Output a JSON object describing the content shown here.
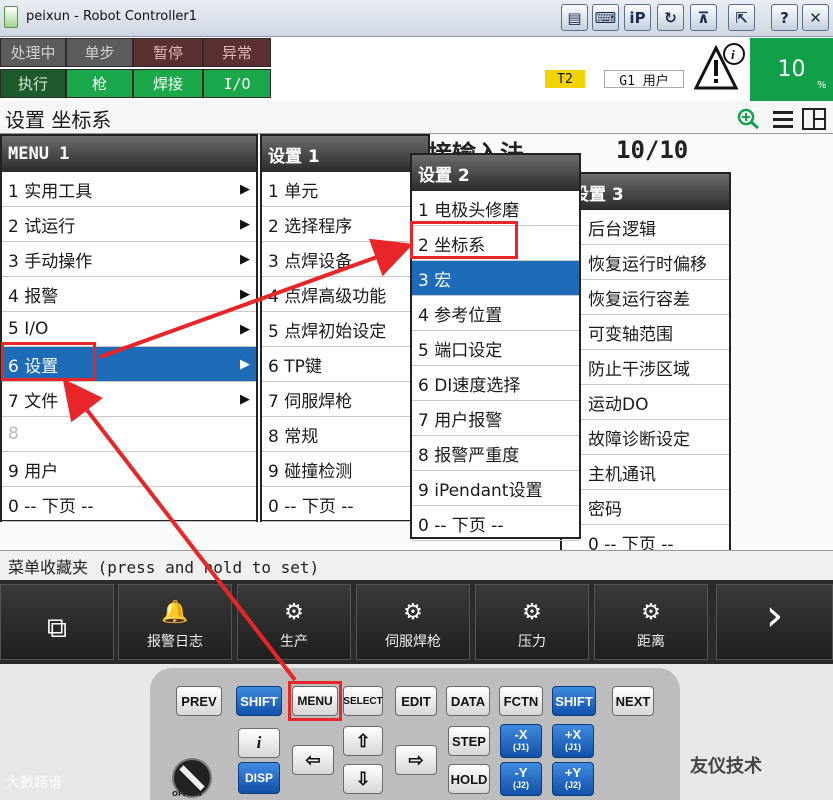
{
  "window": {
    "title": "peixun - Robot Controller1"
  },
  "toolbar": {
    "buttons": [
      {
        "icon": "document-icon",
        "glyph": "▤"
      },
      {
        "icon": "keyboard-icon",
        "glyph": "⌨"
      },
      {
        "icon": "ipendant-icon",
        "glyph": "iP"
      },
      {
        "icon": "refresh-icon",
        "glyph": "↻"
      },
      {
        "icon": "pin-icon",
        "glyph": "⊼"
      },
      {
        "icon": "export-icon",
        "glyph": "⇱"
      },
      {
        "icon": "help-icon",
        "glyph": "?"
      },
      {
        "icon": "close-icon",
        "glyph": "✕"
      }
    ]
  },
  "status": {
    "row1": [
      "处理中",
      "单步",
      "暂停",
      "异常"
    ],
    "row2": [
      "执行",
      "枪",
      "焊接",
      "I/O"
    ],
    "mode": "T2",
    "group": "G1 用户",
    "override": "10",
    "override_unit": "%"
  },
  "screen": {
    "title": "设置 坐标系",
    "bg_title": "接输入法",
    "bg_count": "10/10"
  },
  "menu1": {
    "title": "MENU  1",
    "items": [
      {
        "label": "1 实用工具",
        "arrow": "▶"
      },
      {
        "label": "2 试运行",
        "arrow": "▶"
      },
      {
        "label": "3 手动操作",
        "arrow": "▶"
      },
      {
        "label": "4 报警",
        "arrow": "▶"
      },
      {
        "label": "5 I/O",
        "arrow": "▶"
      },
      {
        "label": "6 设置",
        "arrow": "▶"
      },
      {
        "label": "7 文件",
        "arrow": "▶"
      },
      {
        "label": "8",
        "arrow": ""
      },
      {
        "label": "9 用户",
        "arrow": ""
      },
      {
        "label": "0 -- 下页 --",
        "arrow": ""
      }
    ]
  },
  "menu2": {
    "title": "设置  1",
    "items": [
      "1 单元",
      "2 选择程序",
      "3 点焊设备",
      "4 点焊高级功能",
      "5 点焊初始设定",
      "6 TP键",
      "7 伺服焊枪",
      "8 常规",
      "9 碰撞检测",
      "0 -- 下页 --"
    ]
  },
  "menu3": {
    "title": "设置  2",
    "items": [
      "1 电极头修磨",
      "2 坐标系",
      "3 宏",
      "4 参考位置",
      "5 端口设定",
      "6 DI速度选择",
      "7 用户报警",
      "8 报警严重度",
      "9 iPendant设置",
      "0 -- 下页 --"
    ]
  },
  "menu4": {
    "title": "设置  3",
    "items": [
      "后台逻辑",
      "恢复运行时偏移",
      "恢复运行容差",
      "可变轴范围",
      "防止干涉区域",
      "运动DO",
      "故障诊断设定",
      "主机通讯",
      "密码",
      "0 -- 下页 --"
    ]
  },
  "favorites": "菜单收藏夹 (press and hold to set)",
  "fkeys": [
    {
      "label": "",
      "icon": "window-icon",
      "glyph": "⧉"
    },
    {
      "label": "报警日志",
      "icon": "bell-icon",
      "glyph": "🔔"
    },
    {
      "label": "生产",
      "icon": "production-icon",
      "glyph": "⚙"
    },
    {
      "label": "伺服焊枪",
      "icon": "gun-icon",
      "glyph": "⚙"
    },
    {
      "label": "压力",
      "icon": "pressure-icon",
      "glyph": "⚙"
    },
    {
      "label": "距离",
      "icon": "distance-icon",
      "glyph": "⚙"
    },
    {
      "label": "",
      "icon": "next-icon",
      "glyph": "›"
    }
  ],
  "keys": {
    "prev": "PREV",
    "shift": "SHIFT",
    "menu": "MENU",
    "select": "SELECT",
    "edit": "EDIT",
    "data": "DATA",
    "fctn": "FCTN",
    "shift2": "SHIFT",
    "next": "NEXT",
    "info": "i",
    "disp": "DISP",
    "step": "STEP",
    "hold": "HOLD",
    "minus_x": "-X",
    "minus_x_sub": "(J1)",
    "plus_x": "+X",
    "plus_x_sub": "(J1)",
    "minus_y": "-Y",
    "minus_y_sub": "(J2)",
    "plus_y": "+Y",
    "plus_y_sub": "(J2)",
    "off_on": "OFF  ON"
  },
  "watermark": {
    "right": "友仪技术",
    "left": "大數蹃谙"
  },
  "colors": {
    "highlight": "#e8262a",
    "selected": "#1e6cb8",
    "green": "#10a04a"
  }
}
